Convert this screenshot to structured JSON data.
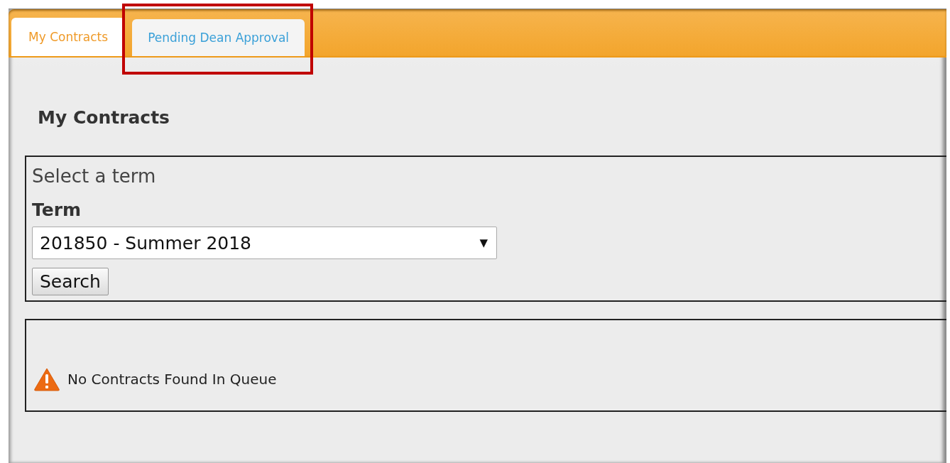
{
  "tabs": [
    {
      "label": "My Contracts",
      "selected": true,
      "highlighted": false
    },
    {
      "label": "Pending Dean Approval",
      "selected": false,
      "highlighted": true
    }
  ],
  "heading": "My Contracts",
  "term_form": {
    "legend": "Select a term",
    "label": "Term",
    "value": "201850 - Summer 2018",
    "arrow": "▼",
    "button": "Search"
  },
  "message": {
    "kind": "warning",
    "text": "No Contracts Found In Queue"
  }
}
